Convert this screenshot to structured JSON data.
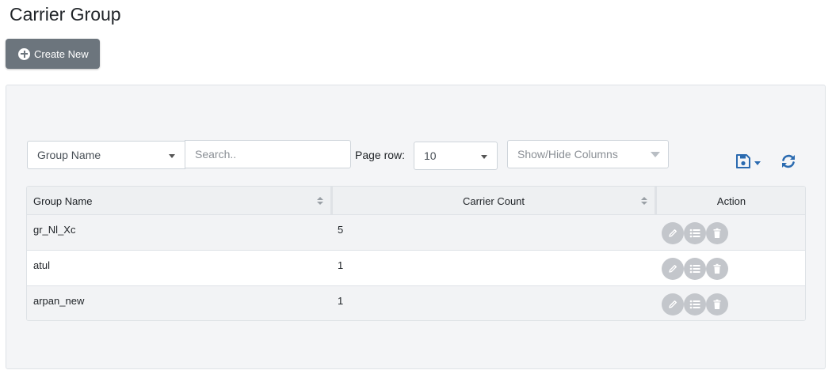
{
  "page": {
    "title": "Carrier Group"
  },
  "toolbar": {
    "create_label": "Create New"
  },
  "filters": {
    "column_select_value": "Group Name",
    "search_placeholder": "Search..",
    "page_row_label": "Page row:",
    "page_row_value": "10",
    "columns_placeholder": "Show/Hide Columns"
  },
  "icons": {
    "create": "plus-circle-icon",
    "save": "floppy-disk-icon",
    "refresh": "refresh-icon",
    "edit": "pencil-icon",
    "list": "list-icon",
    "delete": "trash-icon"
  },
  "colors": {
    "primary_button": "#6c757d",
    "icon_blue": "#2a6ab0",
    "action_circle": "#c3c6cb"
  },
  "table": {
    "headers": [
      "Group Name",
      "Carrier Count",
      "Action"
    ],
    "rows": [
      {
        "group_name": "gr_Nl_Xc",
        "carrier_count": "5"
      },
      {
        "group_name": "atul",
        "carrier_count": "1"
      },
      {
        "group_name": "arpan_new",
        "carrier_count": "1"
      }
    ]
  }
}
